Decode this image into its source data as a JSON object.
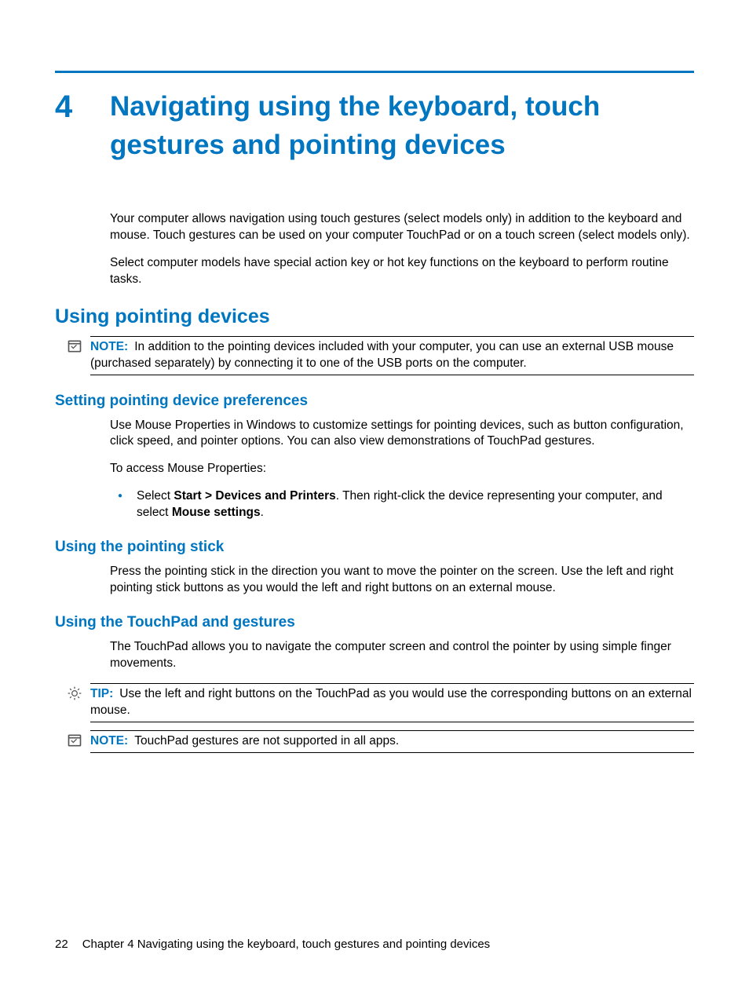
{
  "chapter": {
    "number": "4",
    "title": "Navigating using the keyboard, touch gestures and pointing devices"
  },
  "intro": {
    "p1": "Your computer allows navigation using touch gestures (select models only) in addition to the keyboard and mouse. Touch gestures can be used on your computer TouchPad or on a touch screen (select models only).",
    "p2": "Select computer models have special action key or hot key functions on the keyboard to perform routine tasks."
  },
  "section1": {
    "title": "Using pointing devices",
    "note_label": "NOTE:",
    "note_text": "In addition to the pointing devices included with your computer, you can use an external USB mouse (purchased separately) by connecting it to one of the USB ports on the computer."
  },
  "section2": {
    "title": "Setting pointing device preferences",
    "p1": "Use Mouse Properties in Windows to customize settings for pointing devices, such as button configuration, click speed, and pointer options. You can also view demonstrations of TouchPad gestures.",
    "p2": "To access Mouse Properties:",
    "bullet_pre": "Select ",
    "bullet_bold1": "Start > Devices and Printers",
    "bullet_mid": ". Then right-click the device representing your computer, and select ",
    "bullet_bold2": "Mouse settings",
    "bullet_post": "."
  },
  "section3": {
    "title": "Using the pointing stick",
    "p1": "Press the pointing stick in the direction you want to move the pointer on the screen. Use the left and right pointing stick buttons as you would the left and right buttons on an external mouse."
  },
  "section4": {
    "title": "Using the TouchPad and gestures",
    "p1": "The TouchPad allows you to navigate the computer screen and control the pointer by using simple finger movements.",
    "tip_label": "TIP:",
    "tip_text": "Use the left and right buttons on the TouchPad as you would use the corresponding buttons on an external mouse.",
    "note_label": "NOTE:",
    "note_text": "TouchPad gestures are not supported in all apps."
  },
  "footer": {
    "page": "22",
    "text": "Chapter 4   Navigating using the keyboard, touch gestures and pointing devices"
  }
}
